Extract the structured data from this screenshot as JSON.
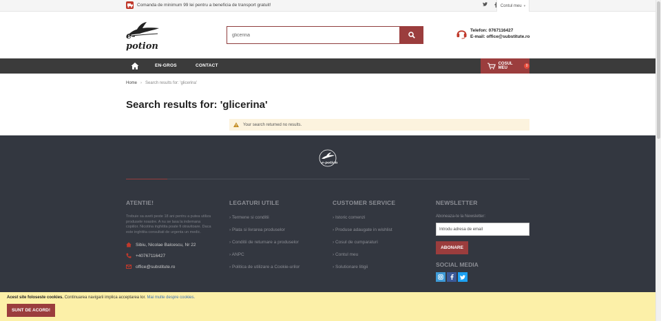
{
  "topbar": {
    "shipping_text": "Comanda de minimum 99 lei pentru a beneficia de transport gratuit!",
    "social": [
      "twitter-icon",
      "facebook-icon",
      "instagram-icon"
    ],
    "account_label": "Contul meu"
  },
  "header": {
    "logo_text": "e-potion",
    "search": {
      "value": "glicerina"
    },
    "phone": "Telefon: 0767116427",
    "email": "E-mail: office@substitute.ro"
  },
  "nav": {
    "items": [
      "EN-GROS",
      "CONTACT"
    ],
    "cart_label": "COSUL MEU",
    "cart_count": "0"
  },
  "breadcrumb": {
    "home": "Home",
    "current": "Search results for: 'glicerina'"
  },
  "main": {
    "title": "Search results for: 'glicerina'",
    "notice": "Your search returned no results."
  },
  "footer": {
    "col1": {
      "heading": "ATENTIE!",
      "text": "Trebuie sa aveti peste 18 ani pentru a putea utiliza produsele noastre. A nu se lasa la indemana copiilor. Nicotina inghitita poate fi otravitoare. Daca este inghitita consultati de urgenta un medic.",
      "address": "Sibiu, Nicolae Balcescu, Nr 22",
      "phone": "+40767116427",
      "email": "office@substitute.ro"
    },
    "col2": {
      "heading": "LEGATURI UTILE",
      "links": [
        "Termene si conditii",
        "Plata si livrarea produselor",
        "Conditii de returnare a produselor",
        "ANPC",
        "Politica de utilizare a Cookie-urilor"
      ]
    },
    "col3": {
      "heading": "CUSTOMER SERVICE",
      "links": [
        "Istoric comenzi",
        "Produse adaugate in wishlist",
        "Cosul de cumparaturi",
        "Contul meu",
        "Solutionare litigii"
      ]
    },
    "col4": {
      "heading": "NEWSLETTER",
      "subscribe_text": "Aboneaza-te la Newsletter:",
      "input_placeholder": "Introdu adresa de email",
      "button": "ABONARE",
      "social_heading": "SOCIAL MEDIA",
      "social": [
        {
          "icon": "instagram-icon",
          "color": "#3e9ad6"
        },
        {
          "icon": "facebook-icon",
          "color": "#3b5998"
        },
        {
          "icon": "twitter-icon",
          "color": "#1da1f2"
        }
      ]
    }
  },
  "cookie": {
    "bold": "Acest site foloseste cookies.",
    "text": "Continuarea navigarii implica acceptarea lor.",
    "more": "Mai multe despre cookies.",
    "button": "SUNT DE ACORD!"
  },
  "colors": {
    "brand": "#9b3d3d",
    "nav": "#3b3b3b",
    "footer": "#333740",
    "cookie": "#fcf0a8"
  }
}
